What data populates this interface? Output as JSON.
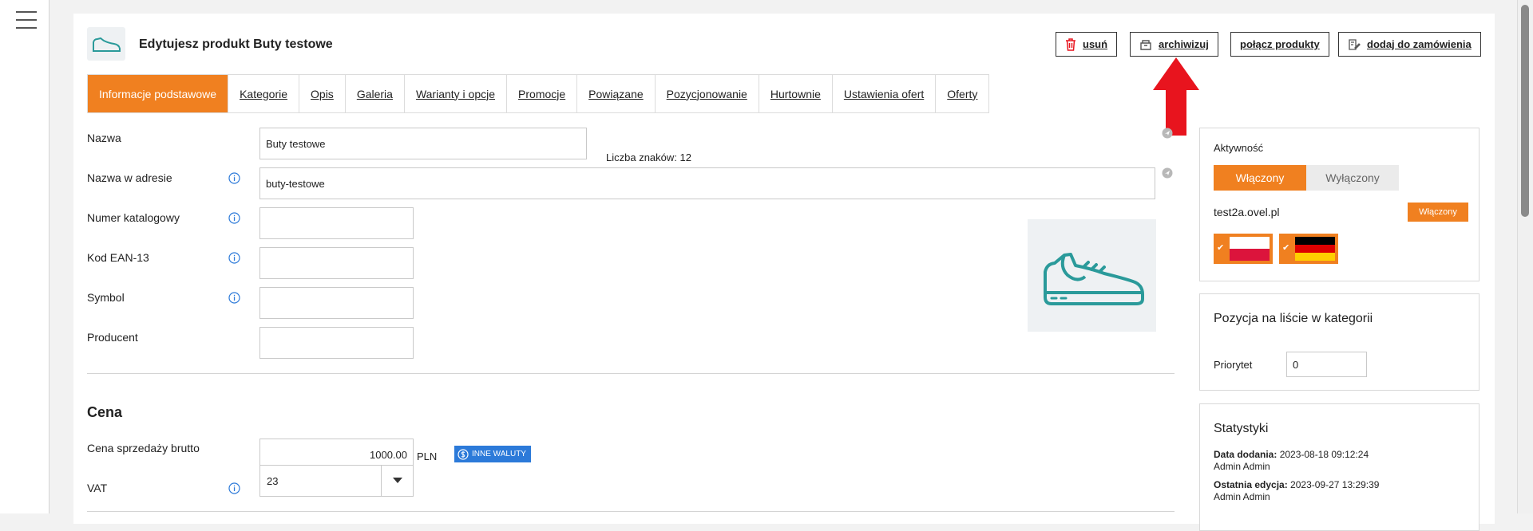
{
  "header": {
    "title": "Edytujesz produkt Buty testowe",
    "buttons": {
      "delete": "usuń",
      "archive": "archiwizuj",
      "merge": "połącz produkty",
      "add_to_order": "dodaj do zamówienia"
    }
  },
  "tabs": [
    {
      "label": "Informacje podstawowe",
      "active": true
    },
    {
      "label": "Kategorie"
    },
    {
      "label": "Opis"
    },
    {
      "label": "Galeria"
    },
    {
      "label": "Warianty i opcje"
    },
    {
      "label": "Promocje"
    },
    {
      "label": "Powiązane"
    },
    {
      "label": "Pozycjonowanie"
    },
    {
      "label": "Hurtownie"
    },
    {
      "label": "Ustawienia ofert"
    },
    {
      "label": "Oferty"
    }
  ],
  "form": {
    "name_label": "Nazwa",
    "name_value": "Buty testowe",
    "char_count": "Liczba znaków: 12",
    "slug_label": "Nazwa w adresie",
    "slug_value": "buty-testowe",
    "catalog_label": "Numer katalogowy",
    "catalog_value": "",
    "ean_label": "Kod EAN-13",
    "ean_value": "",
    "symbol_label": "Symbol",
    "symbol_value": "",
    "producer_label": "Producent",
    "producer_value": ""
  },
  "price": {
    "section_title": "Cena",
    "gross_label": "Cena sprzedaży brutto",
    "gross_value": "1000.00",
    "currency": "PLN",
    "other_currencies": "INNE WALUTY",
    "vat_label": "VAT",
    "vat_value": "23"
  },
  "activity": {
    "title": "Aktywność",
    "on": "Włączony",
    "off": "Wyłączony",
    "domain": "test2a.ovel.pl",
    "domain_status": "Włączony"
  },
  "position": {
    "title": "Pozycja na liście w kategorii",
    "priority_label": "Priorytet",
    "priority_value": "0"
  },
  "stats": {
    "title": "Statystyki",
    "added_label": "Data dodania:",
    "added_value": "2023-08-18 09:12:24",
    "added_by": "Admin Admin",
    "edited_label": "Ostatnia edycja:",
    "edited_value": "2023-09-27 13:29:39",
    "edited_by": "Admin Admin"
  },
  "colors": {
    "accent": "#f08020",
    "blue": "#2c7ad9",
    "icon_teal": "#2a9a9a",
    "arrow_red": "#e8141e"
  }
}
